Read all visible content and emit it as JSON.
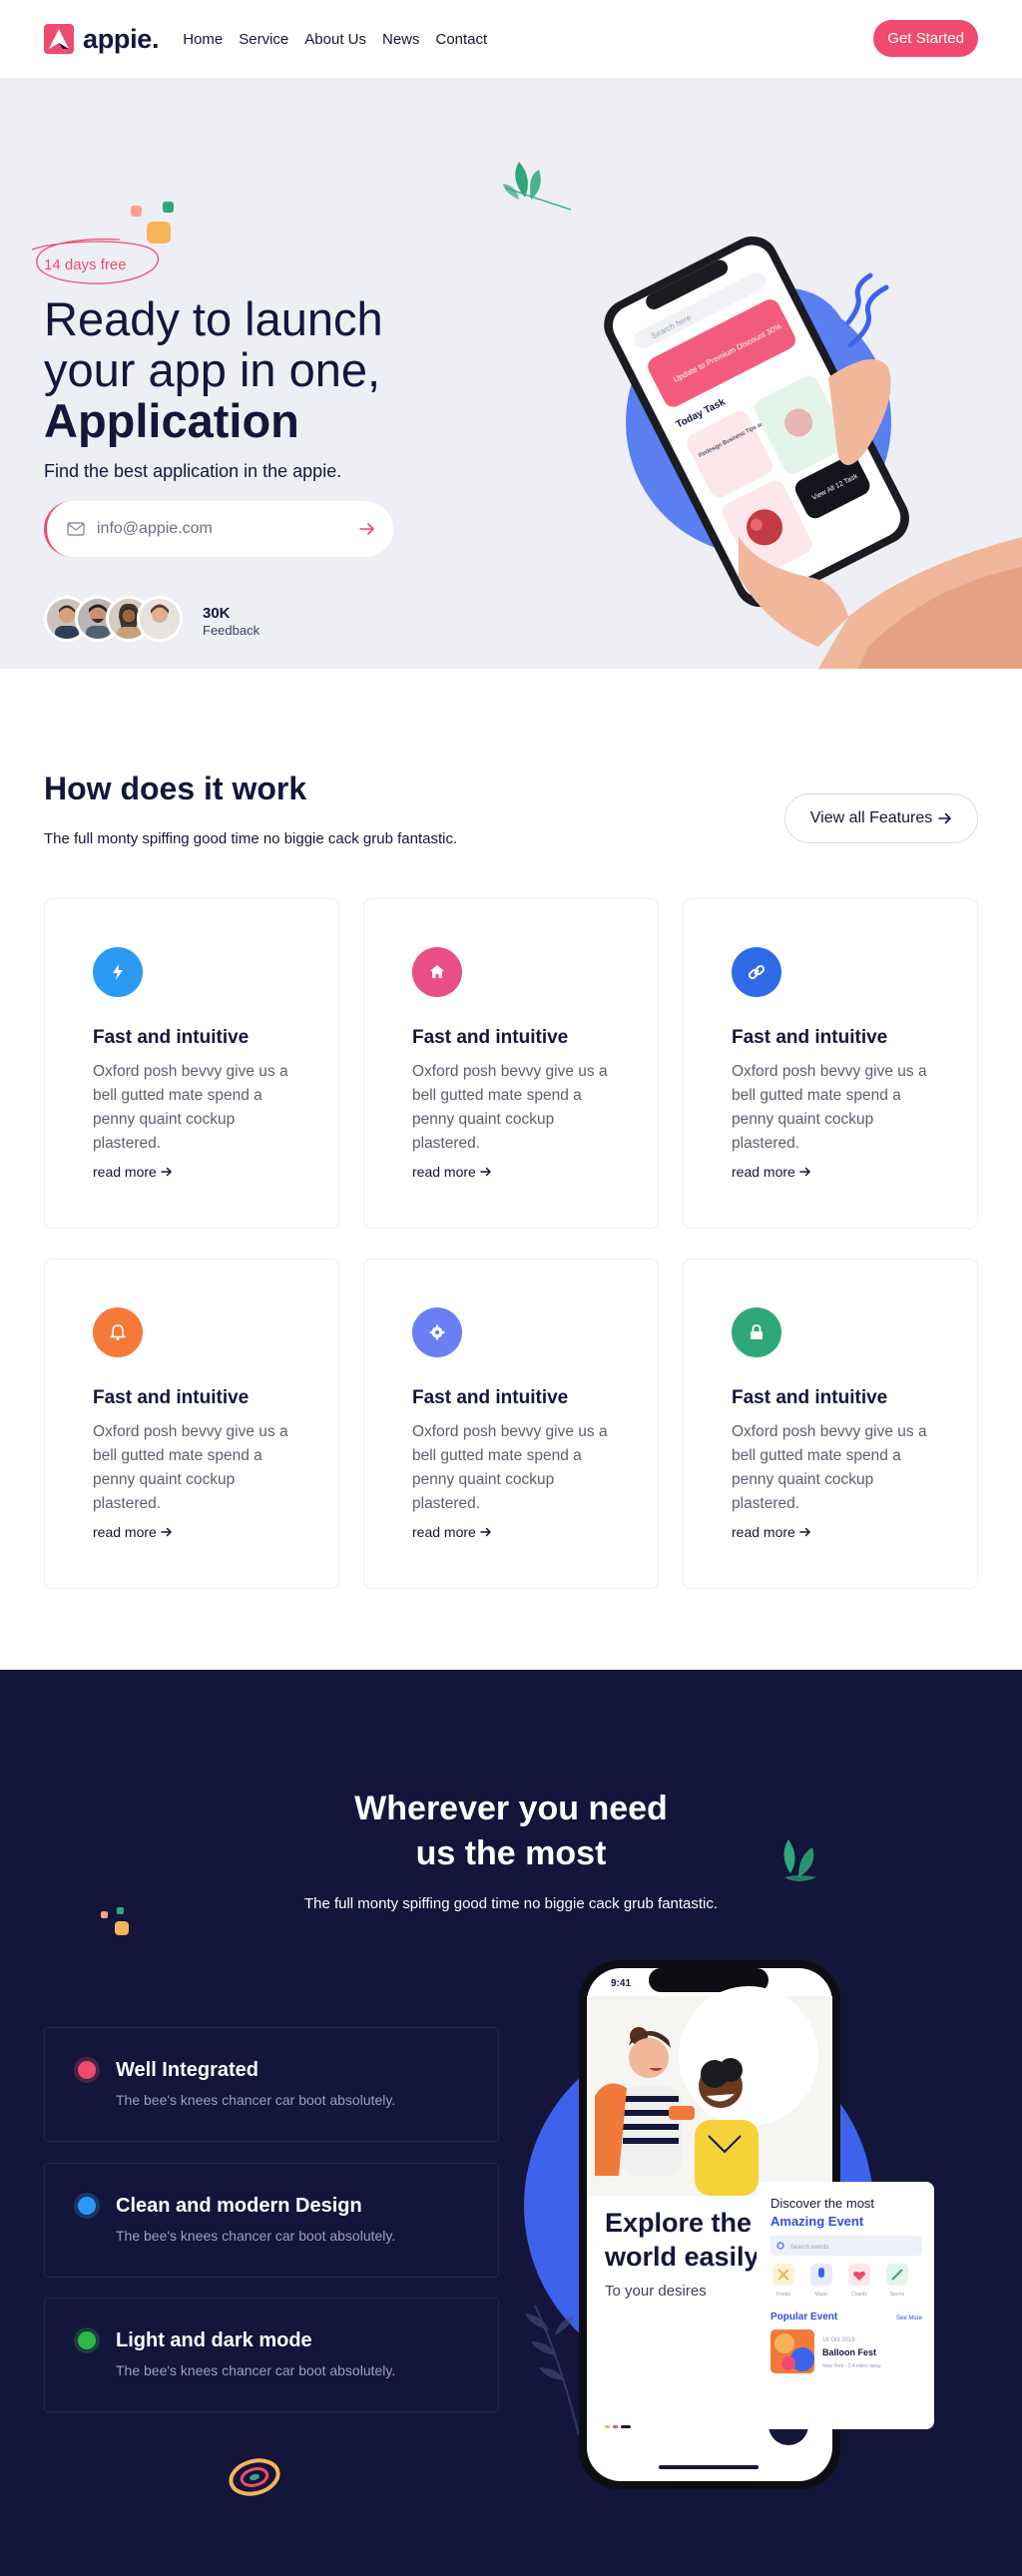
{
  "nav": {
    "logo_text": "appie.",
    "items": [
      "Home",
      "Service",
      "About Us",
      "News",
      "Contact"
    ],
    "cta": "Get Started"
  },
  "hero": {
    "badge": "14 days free",
    "title_line1": "Ready to launch",
    "title_line2": "your app in one,",
    "title_strong": "Application",
    "subtitle": "Find the best application in the appie.",
    "email_placeholder": "info@appie.com",
    "feedback_count": "30K",
    "feedback_label": "Feedback",
    "phone": {
      "search_placeholder": "Search here",
      "banner": "Update to Premium Discount 30%",
      "section": "Today Task",
      "card_text": "Redesign Business Tips and more",
      "dark_card": "View All 12 Task"
    }
  },
  "how": {
    "title": "How does it work",
    "lead": "The full monty spiffing good time no biggie cack grub fantastic.",
    "button": "View all Features",
    "cards": [
      {
        "icon": "bolt-icon",
        "color": "#2b9af3",
        "title": "Fast and intuitive",
        "text": "Oxford posh bevvy give us a bell gutted mate spend a penny quaint cockup plastered.",
        "link": "read more"
      },
      {
        "icon": "home-icon",
        "color": "#e94e86",
        "title": "Fast and intuitive",
        "text": "Oxford posh bevvy give us a bell gutted mate spend a penny quaint cockup plastered.",
        "link": "read more"
      },
      {
        "icon": "link-icon",
        "color": "#2f6ae8",
        "title": "Fast and intuitive",
        "text": "Oxford posh bevvy give us a bell gutted mate spend a penny quaint cockup plastered.",
        "link": "read more"
      },
      {
        "icon": "bell-icon",
        "color": "#f57a3a",
        "title": "Fast and intuitive",
        "text": "Oxford posh bevvy give us a bell gutted mate spend a penny quaint cockup plastered.",
        "link": "read more"
      },
      {
        "icon": "gear-icon",
        "color": "#6b7ff5",
        "title": "Fast and intuitive",
        "text": "Oxford posh bevvy give us a bell gutted mate spend a penny quaint cockup plastered.",
        "link": "read more"
      },
      {
        "icon": "lock-icon",
        "color": "#2fa77b",
        "title": "Fast and intuitive",
        "text": "Oxford posh bevvy give us a bell gutted mate spend a penny quaint cockup plastered.",
        "link": "read more"
      }
    ]
  },
  "dark": {
    "title_line1": "Wherever you need",
    "title_line2": "us the most",
    "lead": "The full monty spiffing good time no biggie cack grub fantastic.",
    "items": [
      {
        "title": "Well Integrated",
        "text": "The bee's knees chancer car boot absolutely.",
        "color": "#f04a6f"
      },
      {
        "title": "Clean and modern Design",
        "text": "The bee's knees chancer car boot absolutely.",
        "color": "#2b9af3"
      },
      {
        "title": "Light and dark mode",
        "text": "The bee's knees chancer car boot absolutely.",
        "color": "#2fb84a"
      }
    ],
    "phone": {
      "time": "9:41",
      "heading_line1": "Explore the",
      "heading_line2": "world easily",
      "sub": "To your desires"
    },
    "event_card": {
      "title_line1": "Discover the most",
      "title_line2": "Amazing Event",
      "search_placeholder": "Search events",
      "categories": [
        "Foods",
        "Music",
        "Charity",
        "Sports"
      ],
      "popular": "Popular Event",
      "see_more": "See More",
      "event_date": "16 Oct 2019",
      "event_name": "Balloon Fest",
      "event_meta": "New York · 2.4 miles away"
    }
  }
}
